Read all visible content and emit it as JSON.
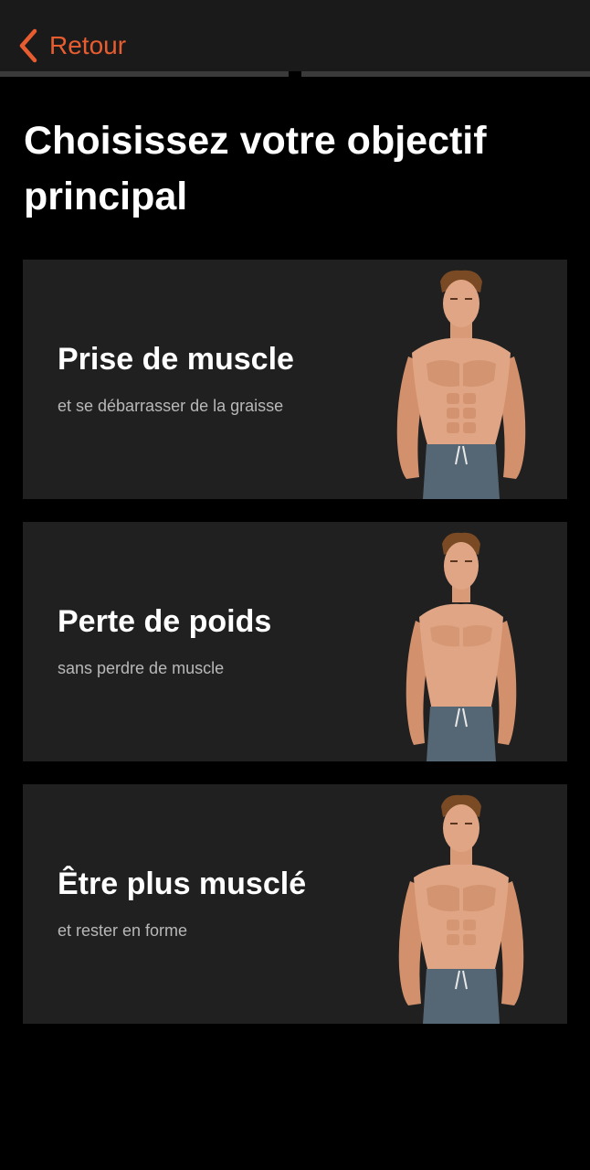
{
  "header": {
    "back_label": "Retour",
    "accent_color": "#e85d30"
  },
  "progress": {
    "steps_total": 2,
    "current_step": 1
  },
  "page": {
    "title": "Choisissez votre objectif principal"
  },
  "goals": [
    {
      "title": "Prise de muscle",
      "subtitle": "et se débarrasser de la graisse",
      "image": "muscular-man-illustration"
    },
    {
      "title": "Perte de poids",
      "subtitle": "sans perdre de muscle",
      "image": "fit-man-illustration"
    },
    {
      "title": "Être plus musclé",
      "subtitle": "et rester en forme",
      "image": "muscular-man-illustration"
    }
  ]
}
